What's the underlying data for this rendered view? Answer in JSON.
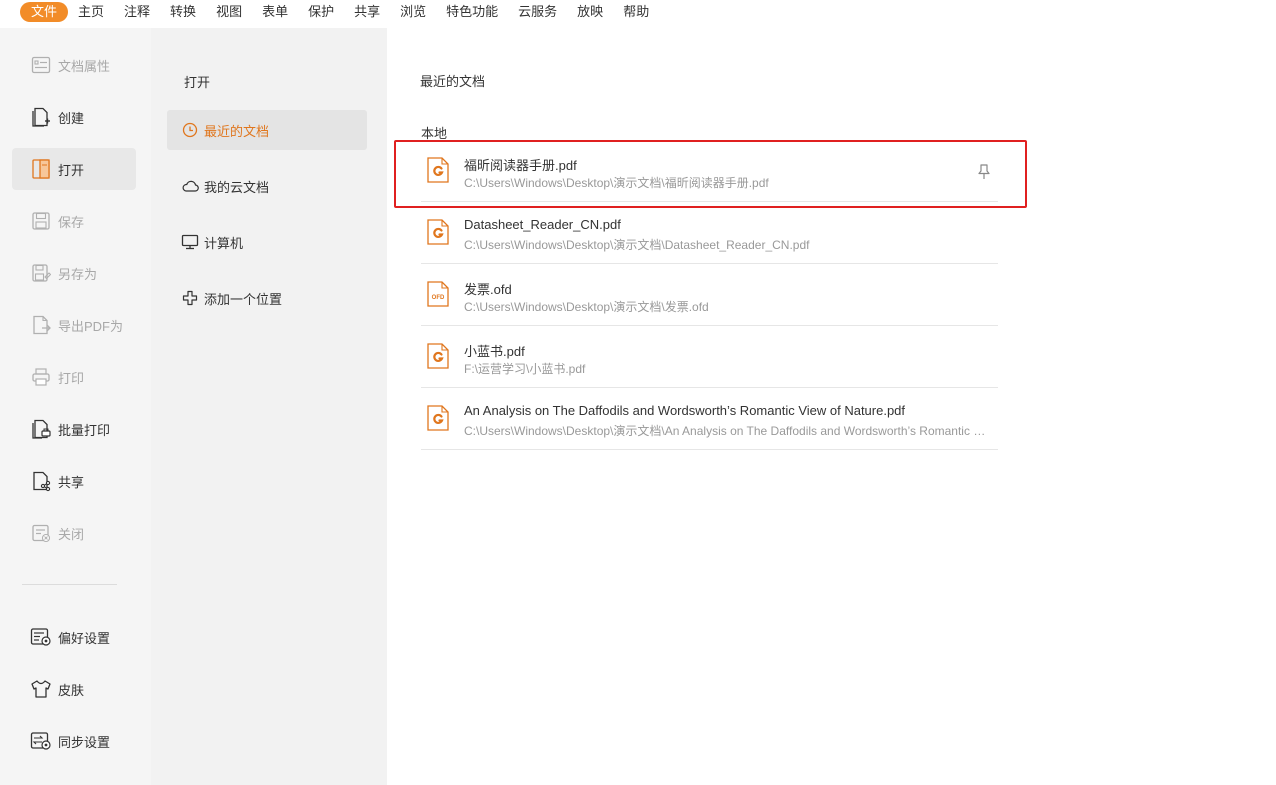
{
  "menubar": {
    "items": [
      "文件",
      "主页",
      "注释",
      "转换",
      "视图",
      "表单",
      "保护",
      "共享",
      "浏览",
      "特色功能",
      "云服务",
      "放映",
      "帮助"
    ],
    "active_index": 0
  },
  "sidebar": {
    "items": [
      {
        "label": "文档属性",
        "icon": "document-properties-icon",
        "enabled": false
      },
      {
        "label": "创建",
        "icon": "create-icon",
        "enabled": true
      },
      {
        "label": "打开",
        "icon": "open-icon",
        "enabled": true,
        "selected": true
      },
      {
        "label": "保存",
        "icon": "save-icon",
        "enabled": false
      },
      {
        "label": "另存为",
        "icon": "save-as-icon",
        "enabled": false
      },
      {
        "label": "导出PDF为",
        "icon": "export-pdf-icon",
        "enabled": false
      },
      {
        "label": "打印",
        "icon": "print-icon",
        "enabled": false
      },
      {
        "label": "批量打印",
        "icon": "batch-print-icon",
        "enabled": true
      },
      {
        "label": "共享",
        "icon": "share-icon",
        "enabled": true
      },
      {
        "label": "关闭",
        "icon": "close-doc-icon",
        "enabled": false
      }
    ],
    "bottom_items": [
      {
        "label": "偏好设置",
        "icon": "preferences-icon"
      },
      {
        "label": "皮肤",
        "icon": "skin-icon"
      },
      {
        "label": "同步设置",
        "icon": "sync-settings-icon"
      }
    ]
  },
  "open_panel": {
    "title": "打开",
    "items": [
      {
        "label": "最近的文档",
        "icon": "clock-icon",
        "selected": true
      },
      {
        "label": "我的云文档",
        "icon": "cloud-icon"
      },
      {
        "label": "计算机",
        "icon": "computer-icon"
      },
      {
        "label": "添加一个位置",
        "icon": "plus-icon"
      }
    ]
  },
  "main": {
    "title": "最近的文档",
    "section": "本地",
    "documents": [
      {
        "name": "福昕阅读器手册.pdf",
        "path": "C:\\Users\\Windows\\Desktop\\演示文档\\福昕阅读器手册.pdf",
        "type": "pdf",
        "highlighted": true
      },
      {
        "name": "Datasheet_Reader_CN.pdf",
        "path": "C:\\Users\\Windows\\Desktop\\演示文档\\Datasheet_Reader_CN.pdf",
        "type": "pdf"
      },
      {
        "name": "发票.ofd",
        "path": "C:\\Users\\Windows\\Desktop\\演示文档\\发票.ofd",
        "type": "ofd",
        "icon_text": "OFD"
      },
      {
        "name": "小蓝书.pdf",
        "path": "F:\\运营学习\\小蓝书.pdf",
        "type": "pdf"
      },
      {
        "name": "An Analysis on The Daffodils and Wordsworth’s Romantic View of Nature.pdf",
        "path": "C:\\Users\\Windows\\Desktop\\演示文档\\An Analysis on The Daffodils and Wordsworth’s Romantic View of Nature.pdf",
        "type": "pdf"
      }
    ]
  },
  "colors": {
    "accent": "#f28c28",
    "accent_text": "#e0761d",
    "highlight_border": "#e02020",
    "disabled_text": "#a8a8a8"
  }
}
